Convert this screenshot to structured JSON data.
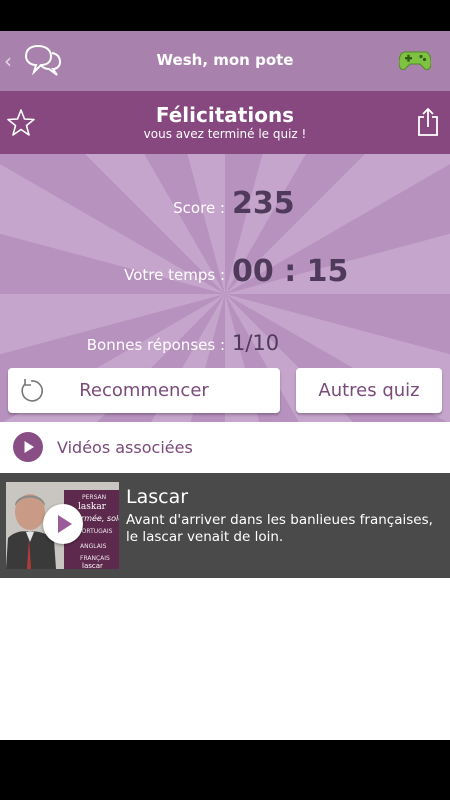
{
  "app_bar": {
    "title": "Wesh, mon pote",
    "back_glyph": "‹",
    "icons": [
      "chevron-left-icon",
      "chat-bubbles-icon",
      "gamepad-icon"
    ]
  },
  "result": {
    "title": "Félicitations",
    "subtitle": "vous avez terminé le quiz !",
    "icons": [
      "star-icon",
      "share-icon"
    ]
  },
  "stats": {
    "score_label": "Score :",
    "score_value": "235",
    "time_label": "Votre temps :",
    "time_value": "00 : 15",
    "correct_label": "Bonnes réponses :",
    "correct_value": "1/10"
  },
  "buttons": {
    "restart_label": "Recommencer",
    "other_label": "Autres quiz"
  },
  "videos": {
    "header_label": "Vidéos associées",
    "items": [
      {
        "title": "Lascar",
        "description": "Avant d'arriver dans les banlieues françaises, le lascar venait de loin.",
        "thumb_words": [
          "PERSAN",
          "laskar",
          "armée, solda",
          "PORTUGAIS",
          "ANGLAIS",
          "FRANÇAIS",
          "lascar"
        ]
      }
    ]
  },
  "colors": {
    "app_bar": "#a882ad",
    "header": "#86487f",
    "panel": "#c5a5cb",
    "accent": "#7a4a7a",
    "value_text": "#4f3a5b"
  }
}
